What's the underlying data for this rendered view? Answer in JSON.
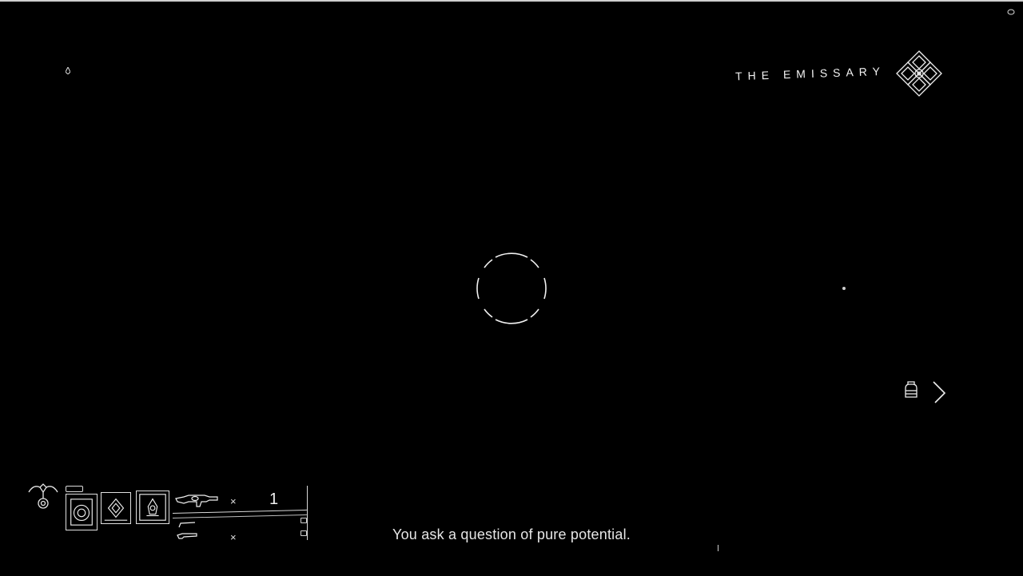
{
  "speaker": {
    "name": "THE EMISSARY",
    "icon": "ghost-shell-icon"
  },
  "subtitle": {
    "text": "You ask a question of pure potential."
  },
  "hud": {
    "primary_weapon": {
      "icon": "auto-rifle-icon",
      "ammo_prefix": "×",
      "count": "1"
    },
    "secondary_weapon": {
      "icon": "sidearm-icon",
      "ammo_prefix": "×"
    },
    "abilities": {
      "grenade_icon": "grenade-icon",
      "melee_icon": "melee-icon",
      "super_icon": "super-icon"
    },
    "class_icon": "class-emblem-icon"
  },
  "interact": {
    "icon": "interact-hand-icon",
    "arrow_icon": "chevron-right-icon"
  },
  "colors": {
    "background": "#000000",
    "line": "#e8e8e8"
  }
}
